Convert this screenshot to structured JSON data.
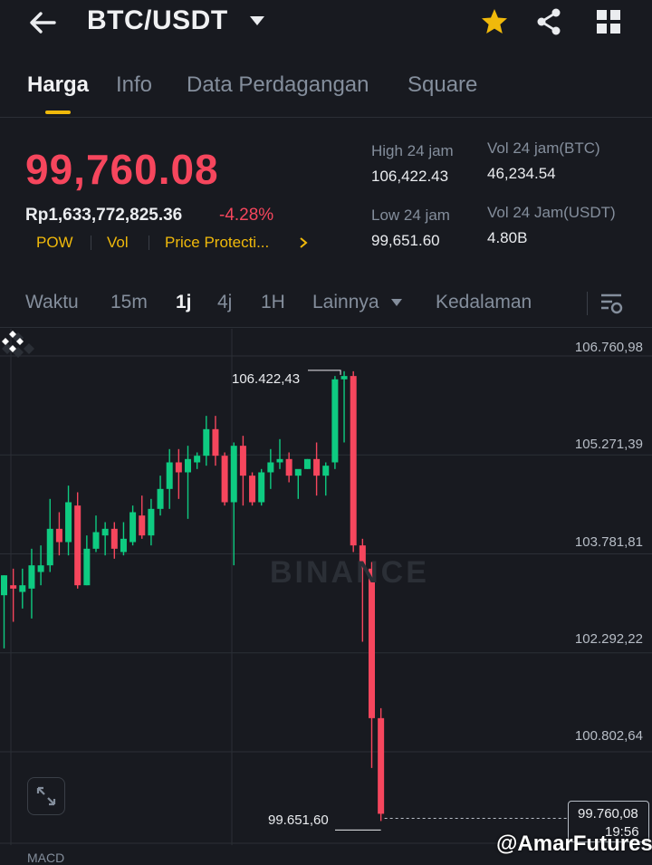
{
  "header": {
    "pair": "BTC/USDT"
  },
  "tabs": [
    {
      "label": "Harga"
    },
    {
      "label": "Info"
    },
    {
      "label": "Data Perdagangan"
    },
    {
      "label": "Square"
    }
  ],
  "ticker": {
    "last_price": "99,760.08",
    "fiat_value": "Rp1,633,772,825.36",
    "change_pct": "-4.28%",
    "tags": [
      "POW",
      "Vol",
      "Price Protecti..."
    ],
    "high_label": "High 24 jam",
    "high_value": "106,422.43",
    "low_label": "Low 24 jam",
    "low_value": "99,651.60",
    "vol_base_label": "Vol 24 jam(BTC)",
    "vol_base_value": "46,234.54",
    "vol_quote_label": "Vol 24 Jam(USDT)",
    "vol_quote_value": "4.80B"
  },
  "interval_bar": {
    "items": [
      "Waktu",
      "15m",
      "1j",
      "4j",
      "1H"
    ],
    "more_label": "Lainnya",
    "depth_label": "Kedalaman",
    "active": "1j"
  },
  "chart": {
    "watermark": "BINANCE",
    "y_ticks": [
      "106.760,98",
      "105.271,39",
      "103.781,81",
      "102.292,22",
      "100.802,64"
    ],
    "high_marker": "106.422,43",
    "low_marker": "99.651,60",
    "last_price_box": "99.760,08",
    "countdown": "19:56",
    "indicator_label": "MACD",
    "credit": "@AmarFutures"
  },
  "chart_data": {
    "type": "candlestick",
    "interval": "1j",
    "ylim": [
      99000,
      107100
    ],
    "y_ticks": [
      106760.98,
      105271.39,
      103781.81,
      102292.22,
      100802.64
    ],
    "candles": [
      {
        "o": 103050,
        "h": 103350,
        "c": 103350,
        "l": 102250
      },
      {
        "o": 103200,
        "h": 103450,
        "c": 103150,
        "l": 102650
      },
      {
        "o": 103100,
        "h": 103450,
        "c": 103200,
        "l": 102850
      },
      {
        "o": 103150,
        "h": 103750,
        "c": 103500,
        "l": 102700
      },
      {
        "o": 103400,
        "h": 103800,
        "c": 103500,
        "l": 103200
      },
      {
        "o": 103500,
        "h": 104500,
        "c": 104050,
        "l": 103400
      },
      {
        "o": 104050,
        "h": 104300,
        "c": 103850,
        "l": 103650
      },
      {
        "o": 103850,
        "h": 104700,
        "c": 104450,
        "l": 103650
      },
      {
        "o": 104400,
        "h": 104600,
        "c": 103200,
        "l": 103150
      },
      {
        "o": 103200,
        "h": 103950,
        "c": 103750,
        "l": 103200
      },
      {
        "o": 103750,
        "h": 104250,
        "c": 104000,
        "l": 103700
      },
      {
        "o": 103950,
        "h": 104150,
        "c": 104050,
        "l": 103650
      },
      {
        "o": 104050,
        "h": 104150,
        "c": 103750,
        "l": 103600
      },
      {
        "o": 103700,
        "h": 104150,
        "c": 103900,
        "l": 103650
      },
      {
        "o": 103850,
        "h": 104400,
        "c": 104300,
        "l": 103800
      },
      {
        "o": 104250,
        "h": 104550,
        "c": 103950,
        "l": 103900
      },
      {
        "o": 103950,
        "h": 104500,
        "c": 104350,
        "l": 103800
      },
      {
        "o": 104350,
        "h": 104850,
        "c": 104650,
        "l": 104250
      },
      {
        "o": 104650,
        "h": 105250,
        "c": 105050,
        "l": 104350
      },
      {
        "o": 105050,
        "h": 105250,
        "c": 104900,
        "l": 104500
      },
      {
        "o": 104900,
        "h": 105300,
        "c": 105100,
        "l": 104200
      },
      {
        "o": 105050,
        "h": 105200,
        "c": 105150,
        "l": 104950
      },
      {
        "o": 105150,
        "h": 105750,
        "c": 105550,
        "l": 105000
      },
      {
        "o": 105550,
        "h": 105750,
        "c": 105150,
        "l": 105000
      },
      {
        "o": 105150,
        "h": 105200,
        "c": 104450,
        "l": 104400
      },
      {
        "o": 104450,
        "h": 105350,
        "c": 105300,
        "l": 103500
      },
      {
        "o": 105300,
        "h": 105450,
        "c": 104850,
        "l": 104400
      },
      {
        "o": 104850,
        "h": 104900,
        "c": 104450,
        "l": 104400
      },
      {
        "o": 104450,
        "h": 104950,
        "c": 104900,
        "l": 104400
      },
      {
        "o": 104900,
        "h": 105250,
        "c": 105050,
        "l": 104650
      },
      {
        "o": 105050,
        "h": 105400,
        "c": 105100,
        "l": 104950
      },
      {
        "o": 105100,
        "h": 105200,
        "c": 104850,
        "l": 104750
      },
      {
        "o": 104850,
        "h": 104900,
        "c": 104950,
        "l": 104500
      },
      {
        "o": 104950,
        "h": 105100,
        "c": 105100,
        "l": 104950
      },
      {
        "o": 105100,
        "h": 105350,
        "c": 104850,
        "l": 104550
      },
      {
        "o": 104850,
        "h": 105050,
        "c": 105000,
        "l": 104550
      },
      {
        "o": 105050,
        "h": 106350,
        "c": 106300,
        "l": 104950
      },
      {
        "o": 106300,
        "h": 106422.43,
        "c": 106350,
        "l": 105350
      },
      {
        "o": 106350,
        "h": 106422.43,
        "c": 103800,
        "l": 103700
      },
      {
        "o": 103800,
        "h": 103900,
        "c": 103450,
        "l": 102350
      },
      {
        "o": 103450,
        "h": 103550,
        "c": 101200,
        "l": 100450
      },
      {
        "o": 101200,
        "h": 101350,
        "c": 99760.08,
        "l": 99651.6
      }
    ]
  },
  "colors": {
    "background": "#181a20",
    "up": "#0ecb81",
    "down": "#f6465d",
    "accent": "#f0b90b",
    "muted": "#848e9c"
  }
}
